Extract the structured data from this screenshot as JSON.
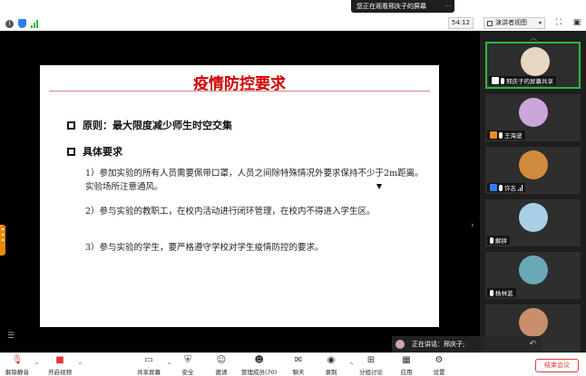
{
  "topbar": {
    "share_banner": "您正在观看邢庆子的屏幕",
    "share_menu": "···",
    "timer": "54:12",
    "view_label": "演讲者视图",
    "view_chevron": "▾"
  },
  "slide": {
    "title": "疫情防控要求",
    "bullet_1": "原则：最大限度减少师生时空交集",
    "bullet_2": "具体要求",
    "items": [
      "1）参加实验的所有人员需要佩带口罩，人员之间除特殊情况外要求保持不少于2m距离。实验场所注意通风。",
      "2）参与实验的教职工，在校内活动进行闭环管理，在校内不得进入学生区。",
      "3）参与实验的学生，要严格遵守学校对学生疫情防控的要求。"
    ]
  },
  "participants": [
    {
      "name": "邢庆子的屏幕共享",
      "avatar_color": "#e8d6c4",
      "role_color": "#ffffff"
    },
    {
      "name": "王海波",
      "avatar_color": "#c9a7d8",
      "role_color": "#f08a24"
    },
    {
      "name": "许志",
      "avatar_color": "#d08b3c",
      "role_color": "#2f7cf6"
    },
    {
      "name": "解拼",
      "avatar_color": "#a8cfe6",
      "role_color": "#ffffff"
    },
    {
      "name": "杨林蓝",
      "avatar_color": "#6aa8b8",
      "role_color": "#ffffff"
    },
    {
      "name": "",
      "avatar_color": "#c98f6a",
      "role_color": "#ffffff"
    }
  ],
  "speaking": {
    "text": "正在讲话：邢庆子;"
  },
  "toolbar": {
    "mute": "解除静音",
    "video": "开启视频",
    "share": "共享屏幕",
    "security": "安全",
    "invite": "邀请",
    "members": "管理成员(70)",
    "chat": "聊天",
    "record": "录制",
    "breakout": "分组讨论",
    "apps": "应用",
    "settings": "设置",
    "end": "结束会议"
  },
  "colors": {
    "title_red": "#d20000",
    "active_border": "#2db744",
    "end_red": "#e03a3a"
  }
}
